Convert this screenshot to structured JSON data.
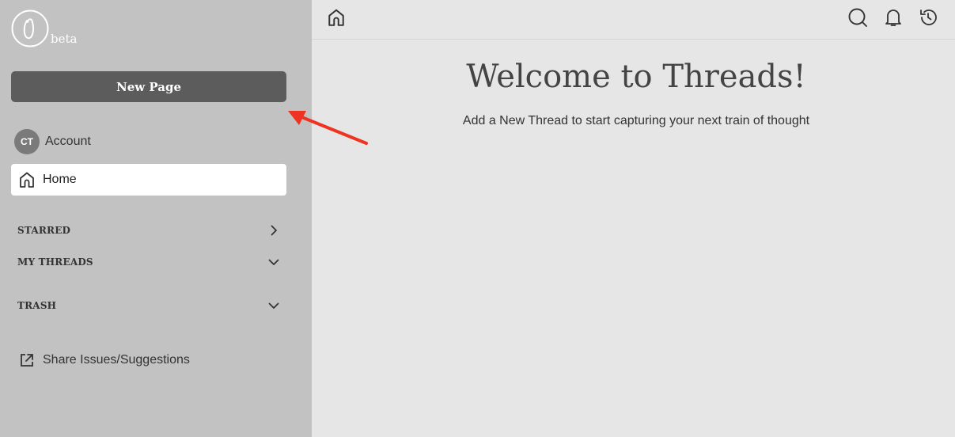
{
  "app": {
    "beta_label": "beta"
  },
  "sidebar": {
    "new_page_label": "New Page",
    "account": {
      "initials": "CT",
      "label": "Account"
    },
    "home_label": "Home",
    "sections": [
      {
        "label": "STARRED",
        "icon": "chevron-right-icon"
      },
      {
        "label": "MY THREADS",
        "icon": "chevron-down-icon"
      },
      {
        "label": "TRASH",
        "icon": "chevron-down-icon"
      }
    ],
    "share_label": "Share Issues/Suggestions"
  },
  "main": {
    "title": "Welcome to Threads!",
    "subtitle": "Add a New Thread to start capturing your next train of thought"
  },
  "colors": {
    "sidebar_bg": "#c2c2c2",
    "main_bg": "#e6e6e6",
    "button_bg": "#5c5c5c",
    "annotation_arrow": "#ee3322"
  }
}
